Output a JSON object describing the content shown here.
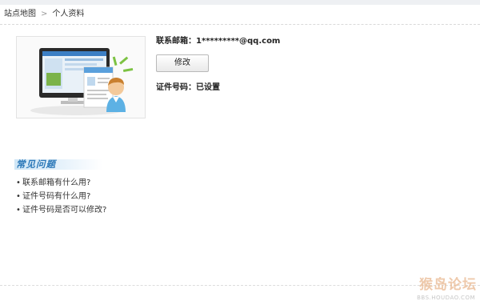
{
  "breadcrumb": {
    "home": "站点地图",
    "separator": ">",
    "current": "个人资料"
  },
  "profile": {
    "email_label": "联系邮箱：",
    "email_value": "1*********@qq.com",
    "edit_button": "修改",
    "id_label": "证件号码：",
    "id_value": "已设置"
  },
  "faq": {
    "title": "常见问题",
    "items": [
      {
        "bullet": "•",
        "text": "联系邮箱有什么用?"
      },
      {
        "bullet": "•",
        "text": "证件号码有什么用?"
      },
      {
        "bullet": "•",
        "text": "证件号码是否可以修改?"
      }
    ]
  },
  "watermark": {
    "logo": "猴岛论坛",
    "url": "BBS.HOUDAO.COM"
  },
  "colors": {
    "faq_title": "#2b78b8",
    "accent_green": "#7cc242",
    "monitor_dark": "#2a2a2a"
  },
  "icons": [
    "chevron-right-icon",
    "profile-illustration"
  ]
}
